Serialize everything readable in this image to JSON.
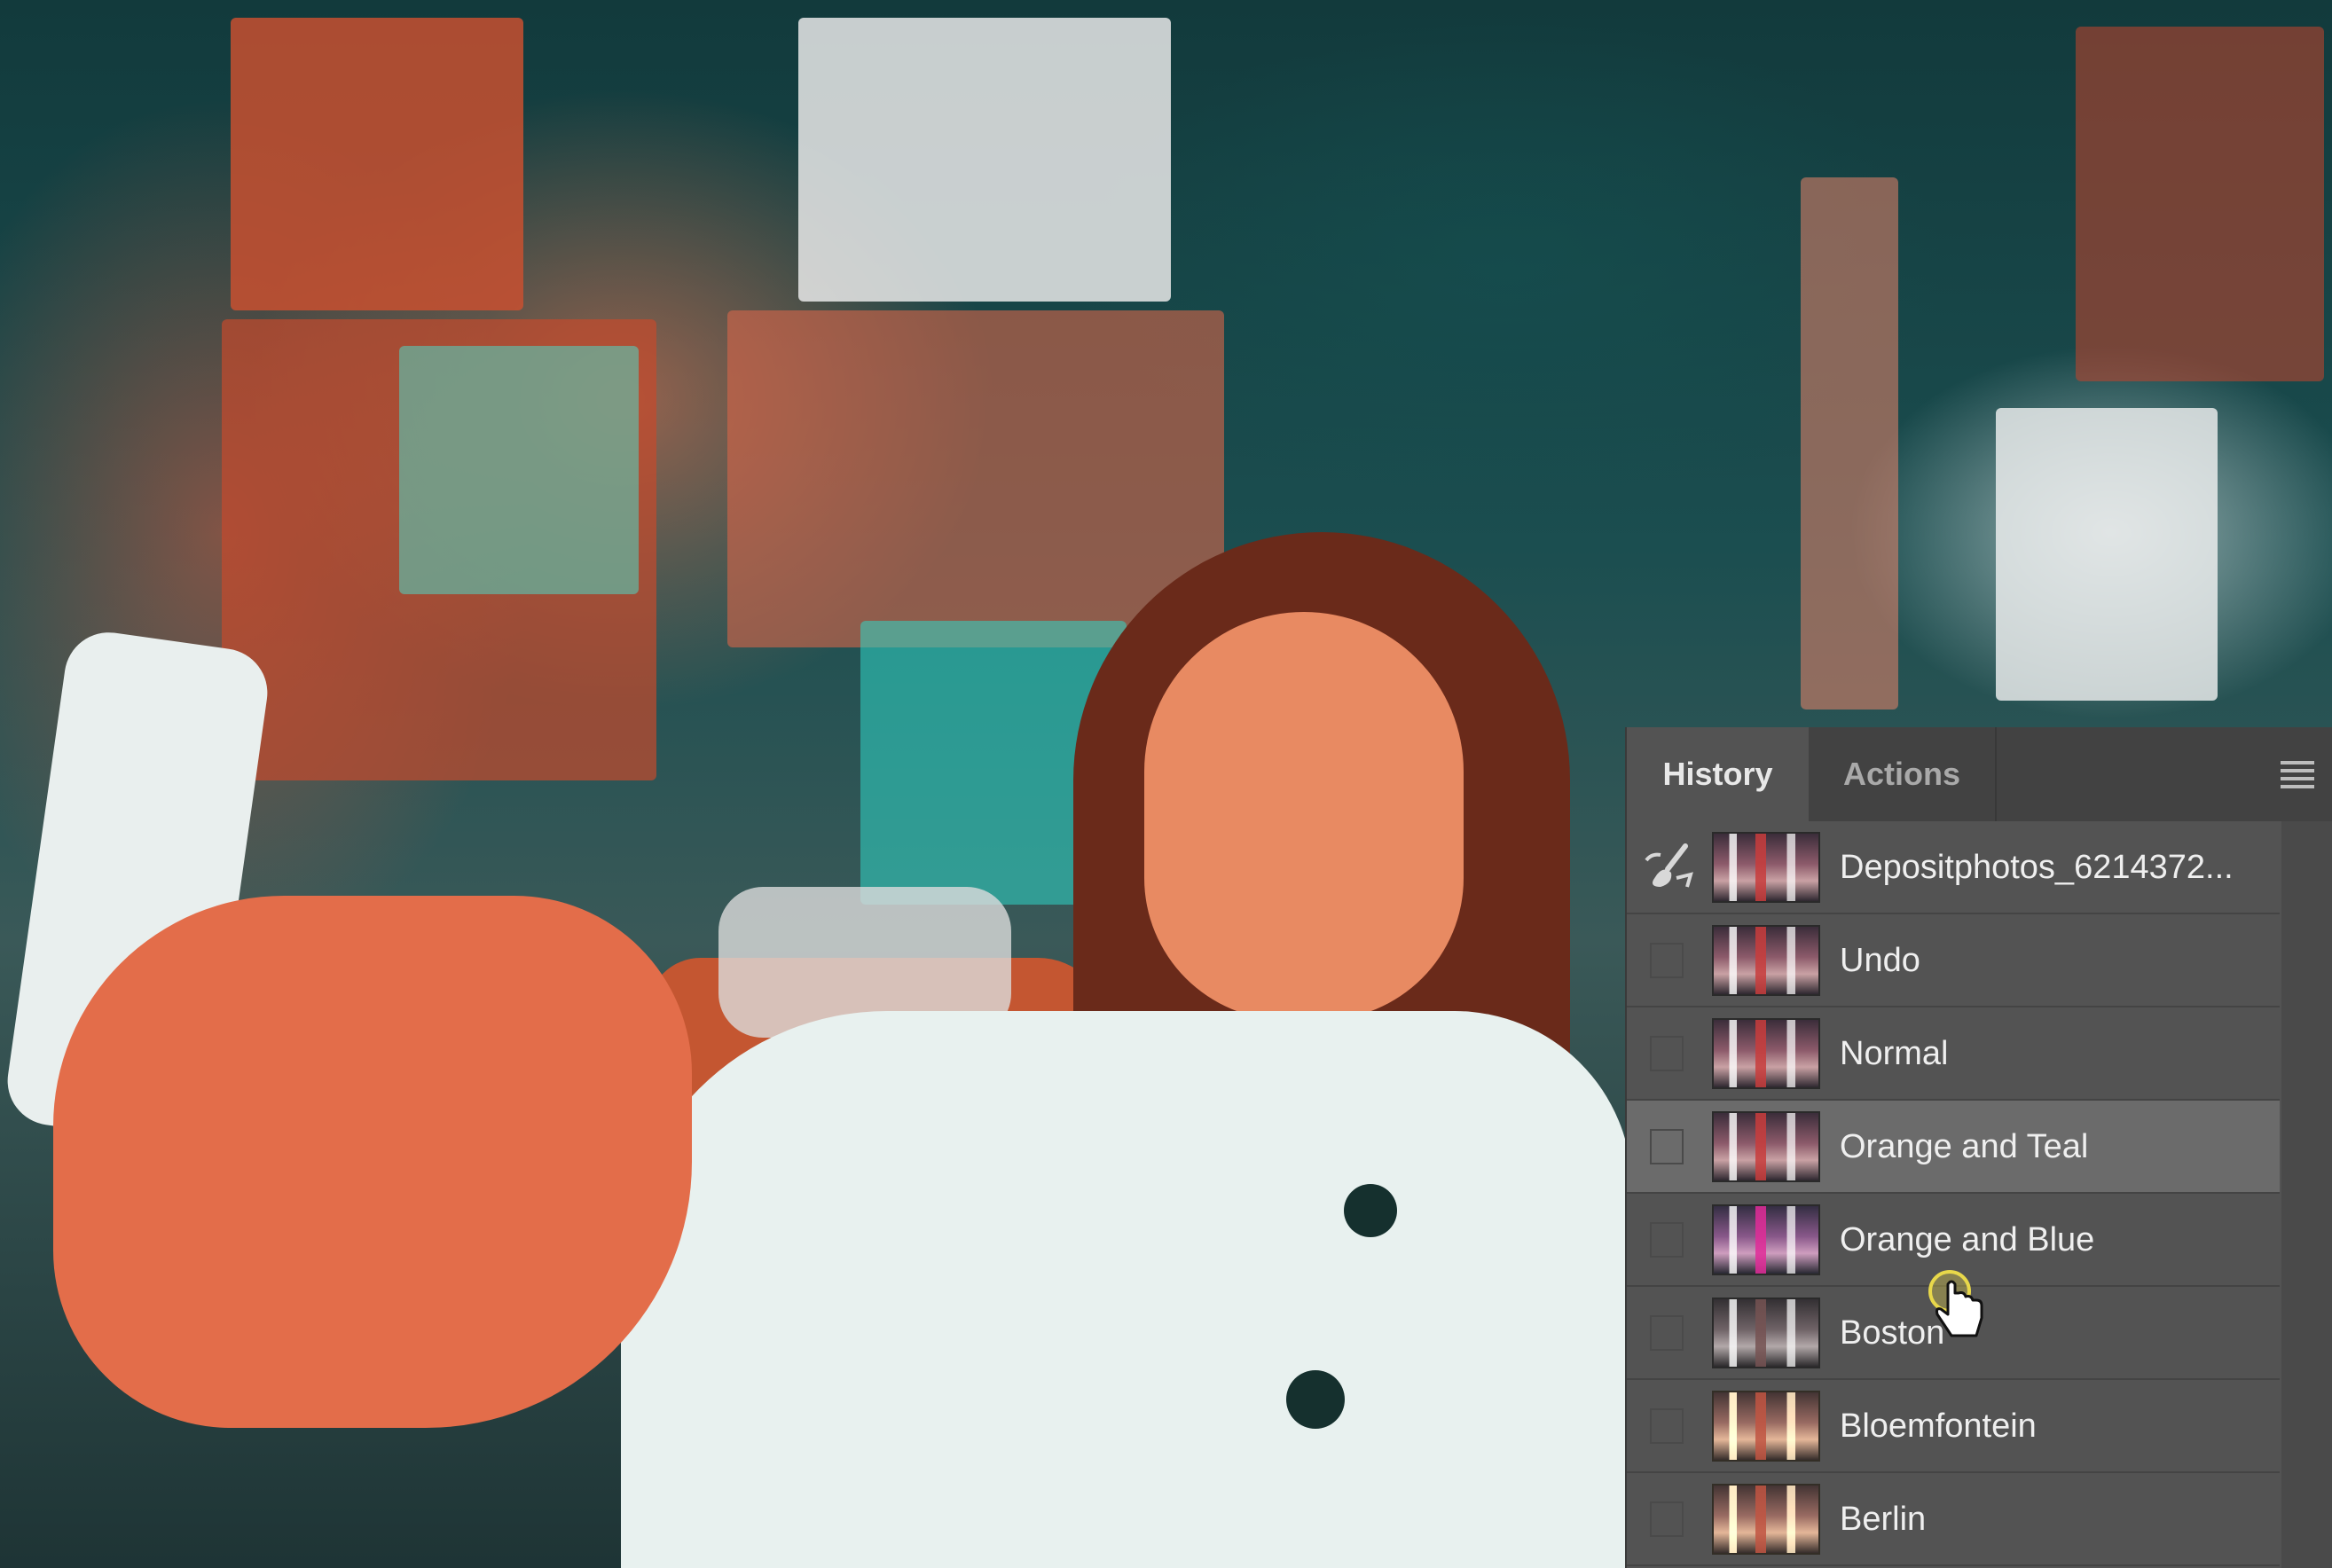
{
  "history_panel": {
    "tabs": [
      {
        "label": "History",
        "active": true
      },
      {
        "label": "Actions",
        "active": false
      }
    ],
    "menu_icon": "hamburger-icon",
    "items": [
      {
        "label": "Depositphotos_6214372...",
        "icon": "history-brush-icon",
        "thumb": "normal"
      },
      {
        "label": "Undo",
        "thumb": "normal"
      },
      {
        "label": "Normal",
        "thumb": "normal"
      },
      {
        "label": "Orange and Teal",
        "thumb": "normal",
        "selected": true
      },
      {
        "label": "Orange and Blue",
        "thumb": "cool"
      },
      {
        "label": "Boston",
        "thumb": "muted"
      },
      {
        "label": "Bloemfontein",
        "thumb": "warm"
      },
      {
        "label": "Berlin",
        "thumb": "warm"
      }
    ]
  },
  "colors": {
    "panel_bg": "#535353",
    "tab_bar_bg": "#424242",
    "selected_row": "#6b6b6b",
    "text": "#efefef",
    "cursor_highlight": "#e8d84a"
  }
}
